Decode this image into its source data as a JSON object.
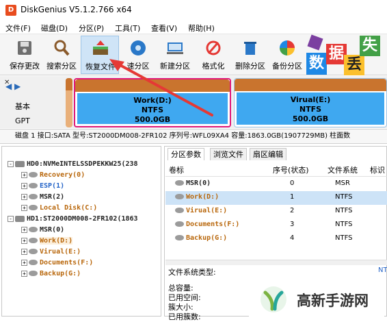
{
  "window": {
    "title": "DiskGenius V5.1.2.766 x64",
    "app_icon_glyph": "D"
  },
  "menu": [
    "文件(F)",
    "磁盘(D)",
    "分区(P)",
    "工具(T)",
    "查看(V)",
    "帮助(H)"
  ],
  "toolbar": {
    "buttons": [
      {
        "label": "保存更改",
        "icon": "save-icon"
      },
      {
        "label": "搜索分区",
        "icon": "search-icon"
      },
      {
        "label": "恢复文件",
        "icon": "recover-icon",
        "active": true
      },
      {
        "label": "速分区",
        "icon": "quick-partition-icon"
      },
      {
        "label": "新建分区",
        "icon": "new-partition-icon"
      },
      {
        "label": "格式化",
        "icon": "format-icon"
      },
      {
        "label": "删除分区",
        "icon": "delete-icon"
      },
      {
        "label": "备份分区",
        "icon": "backup-icon"
      }
    ],
    "tiles": [
      "数",
      "据",
      "丢",
      "失"
    ]
  },
  "diskmap": {
    "side_labels": [
      "基本",
      "GPT"
    ],
    "partitions": [
      {
        "name": "Work(D:)",
        "fs": "NTFS",
        "size": "500.0GB",
        "selected": true
      },
      {
        "name": "Virual(E:)",
        "fs": "NTFS",
        "size": "500.0GB",
        "selected": false
      }
    ]
  },
  "diskinfo": "磁盘 1 接口:SATA  型号:ST2000DM008-2FR102  序列号:WFL09XA4  容量:1863.0GB(1907729MB)  柱面数",
  "tree": {
    "rows": [
      {
        "level": 0,
        "expander": "-",
        "kind": "disk",
        "text": "HD0:NVMeINTELSSDPEKKW25(238",
        "style": "dark"
      },
      {
        "level": 1,
        "expander": "+",
        "kind": "part",
        "text": "Recovery(0)",
        "style": "orange"
      },
      {
        "level": 1,
        "expander": "+",
        "kind": "part",
        "text": "ESP(1)",
        "style": "blue"
      },
      {
        "level": 1,
        "expander": "+",
        "kind": "part",
        "text": "MSR(2)",
        "style": "dark"
      },
      {
        "level": 1,
        "expander": "+",
        "kind": "part",
        "text": "Local Disk(C:)",
        "style": "orange"
      },
      {
        "level": 0,
        "expander": "-",
        "kind": "disk",
        "text": "HD1:ST2000DM008-2FR102(1863",
        "style": "dark"
      },
      {
        "level": 1,
        "expander": "+",
        "kind": "part",
        "text": "MSR(0)",
        "style": "dark"
      },
      {
        "level": 1,
        "expander": "+",
        "kind": "part",
        "text": "Work(D:)",
        "style": "orange",
        "selected": true
      },
      {
        "level": 1,
        "expander": "+",
        "kind": "part",
        "text": "Virual(E:)",
        "style": "orange"
      },
      {
        "level": 1,
        "expander": "+",
        "kind": "part",
        "text": "Documents(F:)",
        "style": "orange"
      },
      {
        "level": 1,
        "expander": "+",
        "kind": "part",
        "text": "Backup(G:)",
        "style": "orange"
      }
    ]
  },
  "rightpanel": {
    "tabs": [
      "分区参数",
      "浏览文件",
      "扇区编辑"
    ],
    "columns": [
      "卷标",
      "序号(状态)",
      "文件系统",
      "标识"
    ],
    "rows": [
      {
        "label": "MSR(0)",
        "index": "0",
        "fs": "MSR",
        "style": "dark"
      },
      {
        "label": "Work(D:)",
        "index": "1",
        "fs": "NTFS",
        "style": "orange",
        "selected": true
      },
      {
        "label": "Virual(E:)",
        "index": "2",
        "fs": "NTFS",
        "style": "orange"
      },
      {
        "label": "Documents(F:)",
        "index": "3",
        "fs": "NTFS",
        "style": "orange"
      },
      {
        "label": "Backup(G:)",
        "index": "4",
        "fs": "NTFS",
        "style": "orange"
      }
    ],
    "fs_type_label": "文件系统类型:",
    "fs_type_value": "NT",
    "stats": [
      "总容量:",
      "已用空间:",
      "簇大小:",
      "已用簇数:"
    ]
  },
  "watermark": {
    "text": "高新手游网"
  },
  "colors": {
    "accent_blue": "#2464c8",
    "partition_orange": "#b8660a",
    "selection": "#cde3f7",
    "highlight_border": "#e0197a",
    "arrow": "#e53935"
  }
}
